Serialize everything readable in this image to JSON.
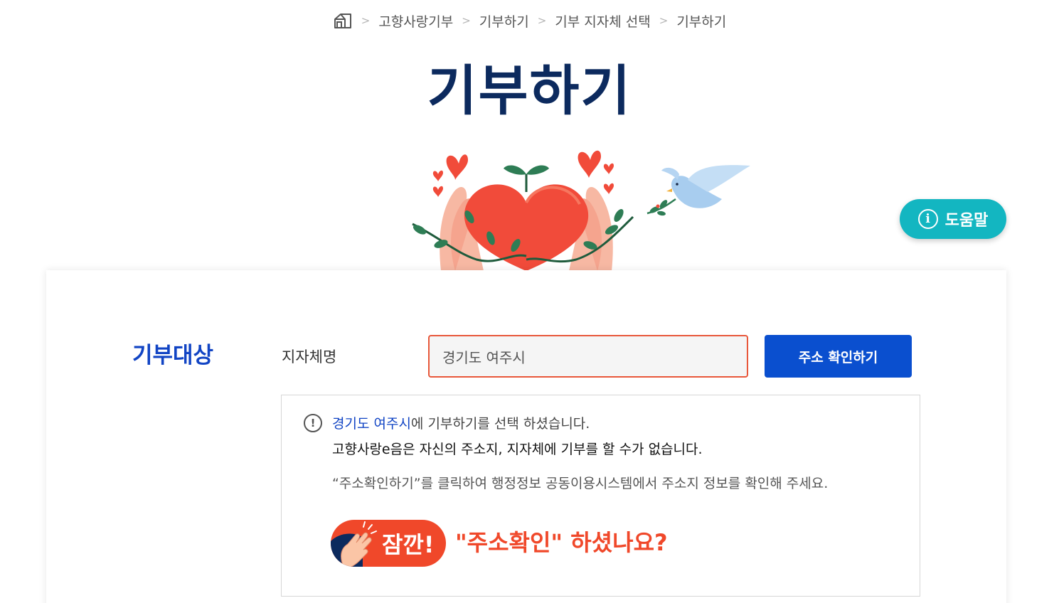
{
  "breadcrumb": {
    "items": [
      "고향사랑기부",
      "기부하기",
      "기부 지자체 선택",
      "기부하기"
    ],
    "separator": ">"
  },
  "page": {
    "title": "기부하기"
  },
  "help": {
    "label": "도움말",
    "icon_glyph": "i"
  },
  "form": {
    "section_label": "기부대상",
    "field_label": "지자체명",
    "region_value": "경기도 여주시",
    "confirm_button": "주소 확인하기"
  },
  "notice": {
    "icon_glyph": "!",
    "region": "경기도 여주시",
    "line1_suffix": "에 기부하기를 선택 하셨습니다.",
    "line2": "고향사랑e음은 자신의 주소지, 지자체에 기부를 할 수가 없습니다.",
    "line3": "“주소확인하기”를 클릭하여 행정정보 공동이용시스템에서 주소지 정보를 확인해 주세요.",
    "wait_label": "잠깐!",
    "wait_question": "\"주소확인\" 하셨나요?"
  },
  "colors": {
    "title": "#0c2a5e",
    "primary": "#0a4fcf",
    "accent": "#f0482a",
    "help": "#13b6c1"
  },
  "icons": [
    "home-icon",
    "info-icon",
    "warning-icon",
    "clap-hand-icon",
    "heart-hands-illustration",
    "dove-illustration"
  ]
}
